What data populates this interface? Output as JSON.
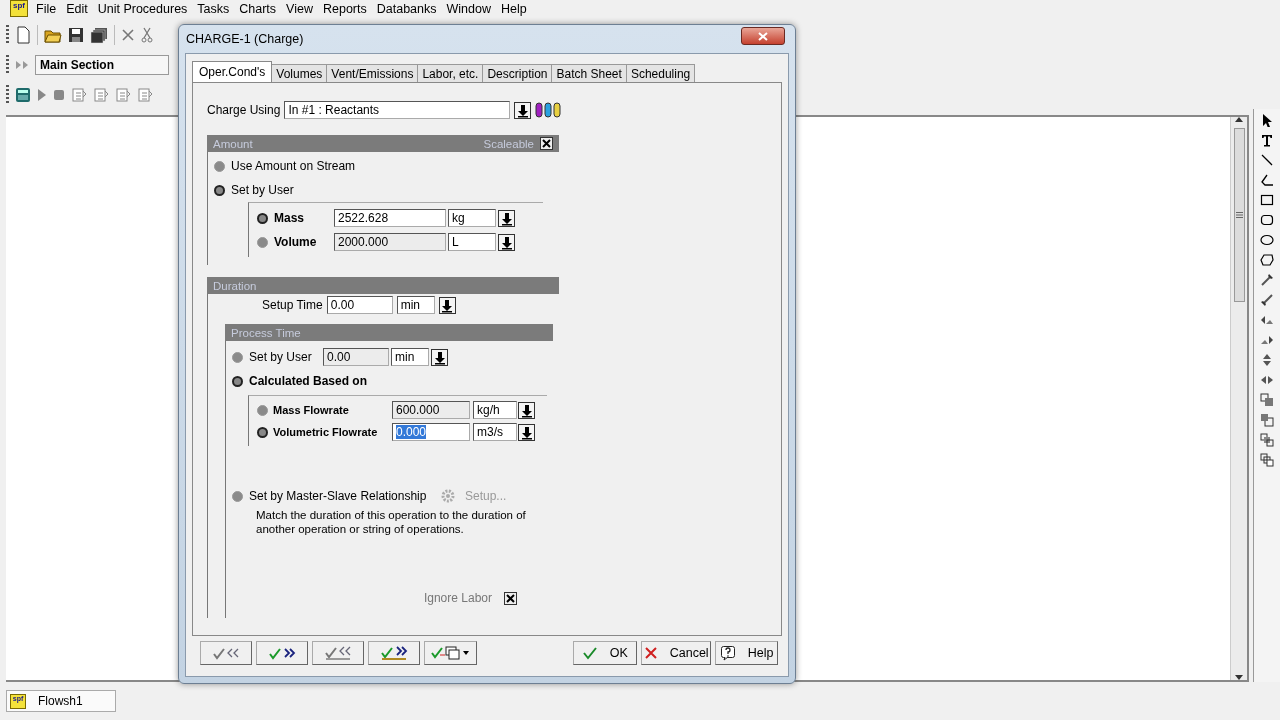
{
  "app_logo": "spf",
  "menu": [
    {
      "label": "File"
    },
    {
      "label": "Edit"
    },
    {
      "label": "Unit Procedures"
    },
    {
      "label": "Tasks"
    },
    {
      "label": "Charts"
    },
    {
      "label": "View"
    },
    {
      "label": "Reports"
    },
    {
      "label": "Databanks"
    },
    {
      "label": "Window"
    },
    {
      "label": "Help"
    }
  ],
  "section_select": {
    "value": "Main Section"
  },
  "dialog": {
    "title": "CHARGE-1 (Charge)",
    "tabs": [
      {
        "label": "Oper.Cond's",
        "selected": true
      },
      {
        "label": "Volumes",
        "selected": false
      },
      {
        "label": "Vent/Emissions",
        "selected": false
      },
      {
        "label": "Labor, etc.",
        "selected": false
      },
      {
        "label": "Description",
        "selected": false
      },
      {
        "label": "Batch Sheet",
        "selected": false
      },
      {
        "label": "Scheduling",
        "selected": false
      }
    ],
    "charge_using": {
      "label": "Charge Using",
      "value": "In #1 : Reactants"
    },
    "amount": {
      "title": "Amount",
      "scaleable": {
        "label": "Scaleable",
        "checked": true
      },
      "options": [
        {
          "label": "Use Amount on Stream",
          "selected": false
        },
        {
          "label": "Set by User",
          "selected": true
        }
      ],
      "quantities": [
        {
          "label": "Mass",
          "selected": true,
          "value": "2522.628",
          "unit": "kg",
          "disabled": false
        },
        {
          "label": "Volume",
          "selected": false,
          "value": "2000.000",
          "unit": "L",
          "disabled": true
        }
      ]
    },
    "duration": {
      "title": "Duration",
      "setup_time": {
        "label": "Setup Time",
        "value": "0.00",
        "unit": "min"
      },
      "process_time": {
        "title": "Process Time",
        "set_by_user": {
          "label": "Set by User",
          "selected": false,
          "value": "0.00",
          "unit": "min",
          "disabled": true
        },
        "calculated": {
          "label": "Calculated Based on",
          "selected": true
        },
        "flowrates": [
          {
            "label": "Mass Flowrate",
            "selected": false,
            "value": "600.000",
            "unit": "kg/h",
            "disabled": true,
            "text_selected": false
          },
          {
            "label": "Volumetric Flowrate",
            "selected": true,
            "value": "0.000",
            "unit": "m3/s",
            "disabled": false,
            "text_selected": true
          }
        ],
        "master_slave": {
          "label": "Set by Master-Slave Relationship",
          "selected": false,
          "setup_label": "Setup...",
          "description": "Match the duration of this operation to the duration of another operation or string of operations."
        },
        "ignore_labor": {
          "label": "Ignore Labor",
          "checked": true
        }
      }
    },
    "buttons": [
      {
        "kind": "prev"
      },
      {
        "kind": "next"
      },
      {
        "kind": "prev-all"
      },
      {
        "kind": "next-all"
      },
      {
        "kind": "copy-menu"
      },
      {
        "kind": "ok",
        "label": "OK"
      },
      {
        "kind": "cancel",
        "label": "Cancel"
      },
      {
        "kind": "help",
        "label": "Help"
      }
    ]
  },
  "document_tabs": [
    {
      "label": "Flowsh1",
      "logo": "spf"
    }
  ]
}
